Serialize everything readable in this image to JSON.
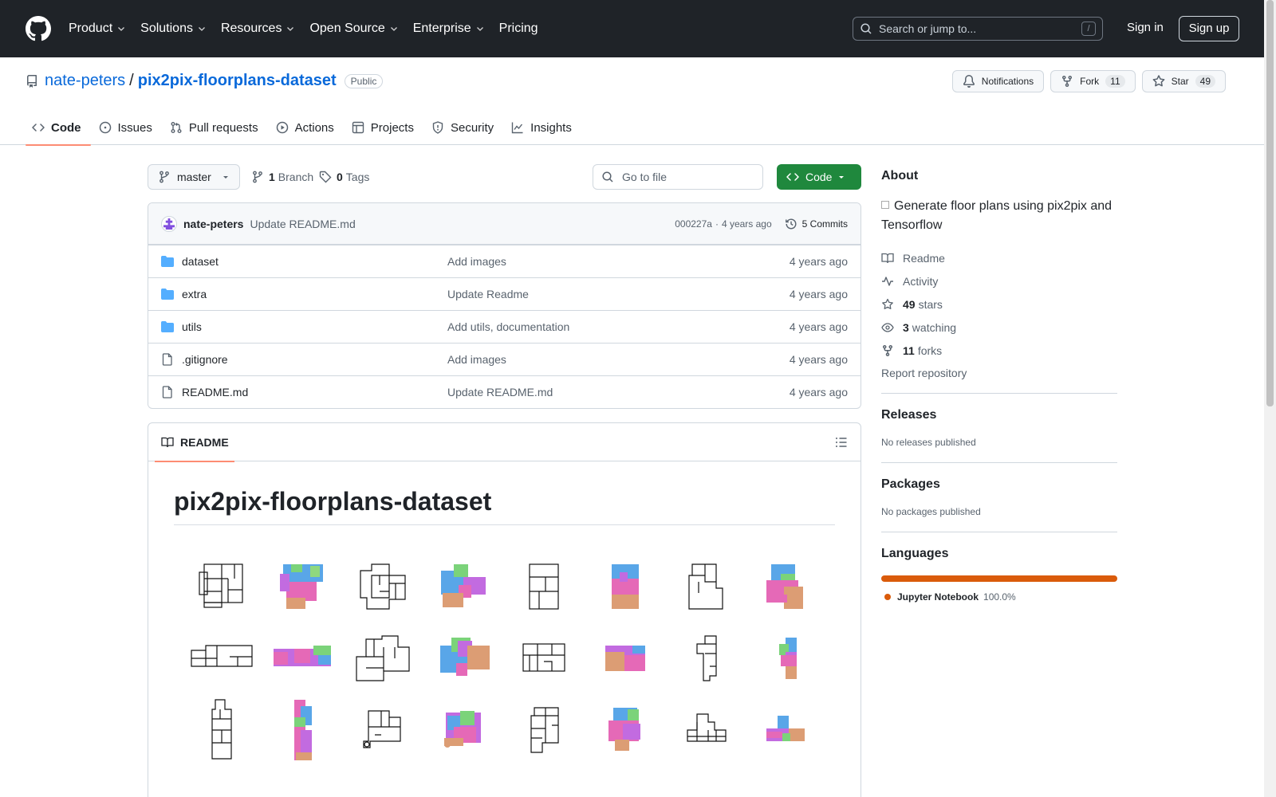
{
  "header": {
    "nav": [
      "Product",
      "Solutions",
      "Resources",
      "Open Source",
      "Enterprise",
      "Pricing"
    ],
    "search_placeholder": "Search or jump to...",
    "search_shortcut": "/",
    "sign_in": "Sign in",
    "sign_up": "Sign up"
  },
  "repo": {
    "owner": "nate-peters",
    "separator": "/",
    "name": "pix2pix-floorplans-dataset",
    "visibility": "Public",
    "notifications_label": "Notifications",
    "fork_label": "Fork",
    "fork_count": "11",
    "star_label": "Star",
    "star_count": "49"
  },
  "tabs": [
    "Code",
    "Issues",
    "Pull requests",
    "Actions",
    "Projects",
    "Security",
    "Insights"
  ],
  "toolbar": {
    "branch": "master",
    "branch_count": "1",
    "branch_label": "Branch",
    "tag_count": "0",
    "tag_label": "Tags",
    "goto_placeholder": "Go to file",
    "code_button": "Code"
  },
  "latest_commit": {
    "author": "nate-peters",
    "message": "Update README.md",
    "hash": "000227a",
    "dot": "·",
    "time": "4 years ago",
    "commits_label": "5 Commits"
  },
  "files": [
    {
      "type": "folder",
      "name": "dataset",
      "message": "Add images",
      "date": "4 years ago"
    },
    {
      "type": "folder",
      "name": "extra",
      "message": "Update Readme",
      "date": "4 years ago"
    },
    {
      "type": "folder",
      "name": "utils",
      "message": "Add utils, documentation",
      "date": "4 years ago"
    },
    {
      "type": "file",
      "name": ".gitignore",
      "message": "Add images",
      "date": "4 years ago"
    },
    {
      "type": "file",
      "name": "README.md",
      "message": "Update README.md",
      "date": "4 years ago"
    }
  ],
  "readme": {
    "tab_label": "README",
    "heading": "pix2pix-floorplans-dataset"
  },
  "sidebar": {
    "about_title": "About",
    "description": "Generate floor plans using pix2pix and Tensorflow",
    "links": [
      {
        "icon": "book-icon",
        "bold": "",
        "text": "Readme"
      },
      {
        "icon": "pulse-icon",
        "bold": "",
        "text": "Activity"
      },
      {
        "icon": "star-icon",
        "bold": "49",
        "text": "stars"
      },
      {
        "icon": "eye-icon",
        "bold": "3",
        "text": "watching"
      },
      {
        "icon": "fork-icon",
        "bold": "11",
        "text": "forks"
      }
    ],
    "report": "Report repository",
    "releases_title": "Releases",
    "releases_text": "No releases published",
    "packages_title": "Packages",
    "packages_text": "No packages published",
    "languages_title": "Languages",
    "languages": [
      {
        "name": "Jupyter Notebook",
        "percent": "100.0%",
        "color": "#DA5B0B"
      }
    ]
  },
  "colors": {
    "header_bg": "#1f2328",
    "link": "#0969da",
    "code_button": "#1f883d",
    "tab_underline": "#fd8c73",
    "folder": "#54aeff"
  }
}
